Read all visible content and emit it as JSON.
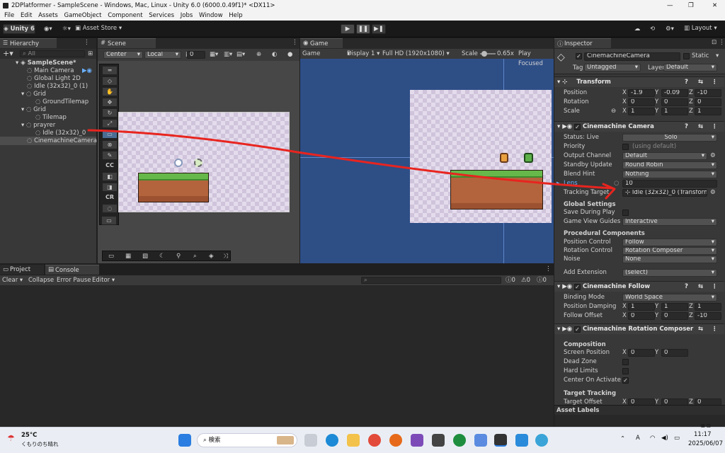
{
  "window": {
    "title": "2DPlatformer - SampleScene - Windows, Mac, Linux - Unity 6.0 (6000.0.49f1)* <DX11>"
  },
  "menu": [
    "File",
    "Edit",
    "Assets",
    "GameObject",
    "Component",
    "Services",
    "Jobs",
    "Window",
    "Help"
  ],
  "toolbar": {
    "account": "Unity 6",
    "asset_store": "Asset Store",
    "layout": "Layout"
  },
  "hierarchy": {
    "tab": "Hierarchy",
    "search": "All",
    "items": [
      {
        "label": "SampleScene*"
      },
      {
        "label": "Main Camera"
      },
      {
        "label": "Global Light 2D"
      },
      {
        "label": "Idle (32x32)_0 (1)"
      },
      {
        "label": "Grid"
      },
      {
        "label": "GroundTilemap"
      },
      {
        "label": "Grid"
      },
      {
        "label": "Tilemap"
      },
      {
        "label": "prayrer"
      },
      {
        "label": "Idle (32x32)_0"
      },
      {
        "label": "CinemachineCamera"
      }
    ]
  },
  "scene": {
    "tab": "Scene",
    "pivot": "Center",
    "space": "Local",
    "snap": "0",
    "tools": [
      "CC",
      "CR",
      "CF"
    ]
  },
  "game": {
    "tab": "Game",
    "mode": "Game",
    "display": "Display 1",
    "resolution": "Full HD (1920x1080)",
    "scale_label": "Scale",
    "scale_value": "0.65x",
    "play_focused": "Play Focused"
  },
  "console": {
    "tab_project": "Project",
    "tab_console": "Console",
    "clear": "Clear",
    "collapse": "Collapse",
    "error_pause": "Error Pause",
    "editor": "Editor",
    "counts": [
      "0",
      "0",
      "0"
    ]
  },
  "inspector": {
    "tab": "Inspector",
    "object_name": "CinemachineCamera",
    "static_label": "Static",
    "tag_label": "Tag",
    "tag_value": "Untagged",
    "layer_label": "Layer",
    "layer_value": "Default",
    "transform": {
      "title": "Transform",
      "position_label": "Position",
      "position": [
        "-1.9",
        "-0.09",
        "-10"
      ],
      "rotation_label": "Rotation",
      "rotation": [
        "0",
        "0",
        "0"
      ],
      "scale_label": "Scale",
      "scale": [
        "1",
        "1",
        "1"
      ]
    },
    "cm_camera": {
      "title": "Cinemachine Camera",
      "status_label": "Status: Live",
      "solo": "Solo",
      "priority_label": "Priority",
      "priority_hint": "(using default)",
      "output_channel_label": "Output Channel",
      "output_channel": "Default",
      "standby_label": "Standby Update",
      "standby": "Round Robin",
      "blend_label": "Blend Hint",
      "blend": "Nothing",
      "lens_label": "Lens",
      "lens": "10",
      "tracking_label": "Tracking Target",
      "tracking": "Idle (32x32)_0 (Transform)",
      "global_settings": "Global Settings",
      "save_play_label": "Save During Play",
      "guides_label": "Game View Guides",
      "guides": "Interactive",
      "procedural": "Procedural Components",
      "pos_control_label": "Position Control",
      "pos_control": "Follow",
      "rot_control_label": "Rotation Control",
      "rot_control": "Rotation Composer",
      "noise_label": "Noise",
      "noise": "None",
      "add_ext_label": "Add Extension",
      "add_ext": "(select)"
    },
    "cm_follow": {
      "title": "Cinemachine Follow",
      "binding_label": "Binding Mode",
      "binding": "World Space",
      "damping_label": "Position Damping",
      "damping": [
        "1",
        "1",
        "1"
      ],
      "offset_label": "Follow Offset",
      "offset": [
        "0",
        "0",
        "-10"
      ]
    },
    "cm_rot": {
      "title": "Cinemachine Rotation Composer",
      "composition": "Composition",
      "screen_pos_label": "Screen Position",
      "screen_pos": [
        "0",
        "0"
      ],
      "dead_zone_label": "Dead Zone",
      "hard_limits_label": "Hard Limits",
      "center_label": "Center On Activate",
      "target_tracking": "Target Tracking",
      "target_offset_label": "Target Offset",
      "target_offset": [
        "0",
        "0",
        "0"
      ]
    },
    "asset_labels": "Asset Labels"
  },
  "taskbar": {
    "temp": "25°C",
    "weather": "くもりのち晴れ",
    "search": "検索",
    "time": "11:17",
    "date": "2025/06/07",
    "ime": "A"
  },
  "colors": {
    "annotation_red": "#e8241f",
    "game_bg": "#2e4e86",
    "accent_blue": "#2c5d87"
  }
}
